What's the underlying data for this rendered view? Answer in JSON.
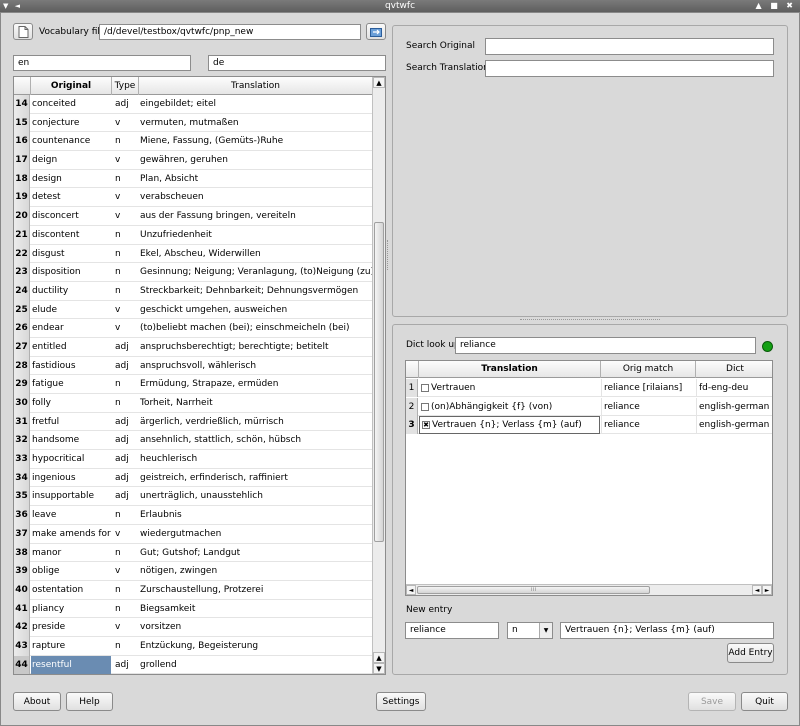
{
  "window": {
    "title": "qvtwfc",
    "controls_left": "▼ ◄",
    "controls_right": "▲ ■ ✖"
  },
  "vocab": {
    "label": "Vocabulary file",
    "path": "/d/devel/testbox/qvtwfc/pnp_new"
  },
  "languages": {
    "source": "en",
    "target": "de"
  },
  "vocab_table": {
    "columns": [
      "Original",
      "Type",
      "Translation"
    ],
    "rows": [
      {
        "num": "14",
        "original": "conceited",
        "type": "adj",
        "translation": "eingebildet; eitel"
      },
      {
        "num": "15",
        "original": "conjecture",
        "type": "v",
        "translation": "vermuten, mutmaßen"
      },
      {
        "num": "16",
        "original": "countenance",
        "type": "n",
        "translation": "Miene, Fassung, (Gemüts-)Ruhe"
      },
      {
        "num": "17",
        "original": "deign",
        "type": "v",
        "translation": "gewähren, geruhen"
      },
      {
        "num": "18",
        "original": "design",
        "type": "n",
        "translation": "Plan, Absicht"
      },
      {
        "num": "19",
        "original": "detest",
        "type": "v",
        "translation": "verabscheuen"
      },
      {
        "num": "20",
        "original": "disconcert",
        "type": "v",
        "translation": "aus der Fassung bringen, vereiteln"
      },
      {
        "num": "21",
        "original": "discontent",
        "type": "n",
        "translation": "Unzufriedenheit"
      },
      {
        "num": "22",
        "original": "disgust",
        "type": "n",
        "translation": "Ekel, Abscheu, Widerwillen"
      },
      {
        "num": "23",
        "original": "disposition",
        "type": "n",
        "translation": "Gesinnung; Neigung; Veranlagung, (to)Neigung (zu)"
      },
      {
        "num": "24",
        "original": "ductility",
        "type": "n",
        "translation": "Streckbarkeit; Dehnbarkeit; Dehnungsvermögen"
      },
      {
        "num": "25",
        "original": "elude",
        "type": "v",
        "translation": "geschickt umgehen, ausweichen"
      },
      {
        "num": "26",
        "original": "endear",
        "type": "v",
        "translation": "(to)beliebt machen (bei); einschmeicheln (bei)"
      },
      {
        "num": "27",
        "original": "entitled",
        "type": "adj",
        "translation": "anspruchsberechtigt; berechtigte; betitelt"
      },
      {
        "num": "28",
        "original": "fastidious",
        "type": "adj",
        "translation": "anspruchsvoll, wählerisch"
      },
      {
        "num": "29",
        "original": "fatigue",
        "type": "n",
        "translation": "Ermüdung, Strapaze, ermüden"
      },
      {
        "num": "30",
        "original": "folly",
        "type": "n",
        "translation": "Torheit, Narrheit"
      },
      {
        "num": "31",
        "original": "fretful",
        "type": "adj",
        "translation": "ärgerlich, verdrießlich, mürrisch"
      },
      {
        "num": "32",
        "original": "handsome",
        "type": "adj",
        "translation": "ansehnlich, stattlich, schön, hübsch"
      },
      {
        "num": "33",
        "original": "hypocritical",
        "type": "adj",
        "translation": "heuchlerisch"
      },
      {
        "num": "34",
        "original": "ingenious",
        "type": "adj",
        "translation": "geistreich, erfinderisch, raffiniert"
      },
      {
        "num": "35",
        "original": "insupportable",
        "type": "adj",
        "translation": "unerträglich, unausstehlich"
      },
      {
        "num": "36",
        "original": "leave",
        "type": "n",
        "translation": "Erlaubnis"
      },
      {
        "num": "37",
        "original": "make amends for",
        "type": "v",
        "translation": "wiedergutmachen"
      },
      {
        "num": "38",
        "original": "manor",
        "type": "n",
        "translation": "Gut; Gutshof; Landgut"
      },
      {
        "num": "39",
        "original": "oblige",
        "type": "v",
        "translation": "nötigen, zwingen"
      },
      {
        "num": "40",
        "original": "ostentation",
        "type": "n",
        "translation": "Zurschaustellung, Protzerei"
      },
      {
        "num": "41",
        "original": "pliancy",
        "type": "n",
        "translation": "Biegsamkeit"
      },
      {
        "num": "42",
        "original": "preside",
        "type": "v",
        "translation": "vorsitzen"
      },
      {
        "num": "43",
        "original": "rapture",
        "type": "n",
        "translation": "Entzückung, Begeisterung"
      },
      {
        "num": "44",
        "original": "resentful",
        "type": "adj",
        "translation": "grollend"
      }
    ]
  },
  "search": {
    "original_label": "Search Original",
    "translation_label": "Search Translation",
    "original_value": "",
    "translation_value": ""
  },
  "dict": {
    "label": "Dict look up",
    "query": "reliance",
    "status_color": "#14a014",
    "columns": [
      "Translation",
      "Orig match",
      "Dict"
    ],
    "rows": [
      {
        "num": "1",
        "checked": false,
        "translation": "Vertrauen",
        "orig_match": "reliance [rilaians]",
        "dict": "fd-eng-deu"
      },
      {
        "num": "2",
        "checked": false,
        "translation": "(on)Abhängigkeit {f} (von)",
        "orig_match": "reliance",
        "dict": "english-german"
      },
      {
        "num": "3",
        "checked": true,
        "translation": "Vertrauen {n}; Verlass {m} (auf)",
        "orig_match": "reliance",
        "dict": "english-german"
      }
    ]
  },
  "new_entry": {
    "label": "New entry",
    "original": "reliance",
    "type": "n",
    "translation": "Vertrauen {n}; Verlass {m} (auf)",
    "add_label": "Add Entry"
  },
  "footer": {
    "about": "About",
    "help": "Help",
    "settings": "Settings",
    "save": "Save",
    "quit": "Quit"
  },
  "icons": {
    "document": "document-icon",
    "open": "folder-open-icon"
  }
}
